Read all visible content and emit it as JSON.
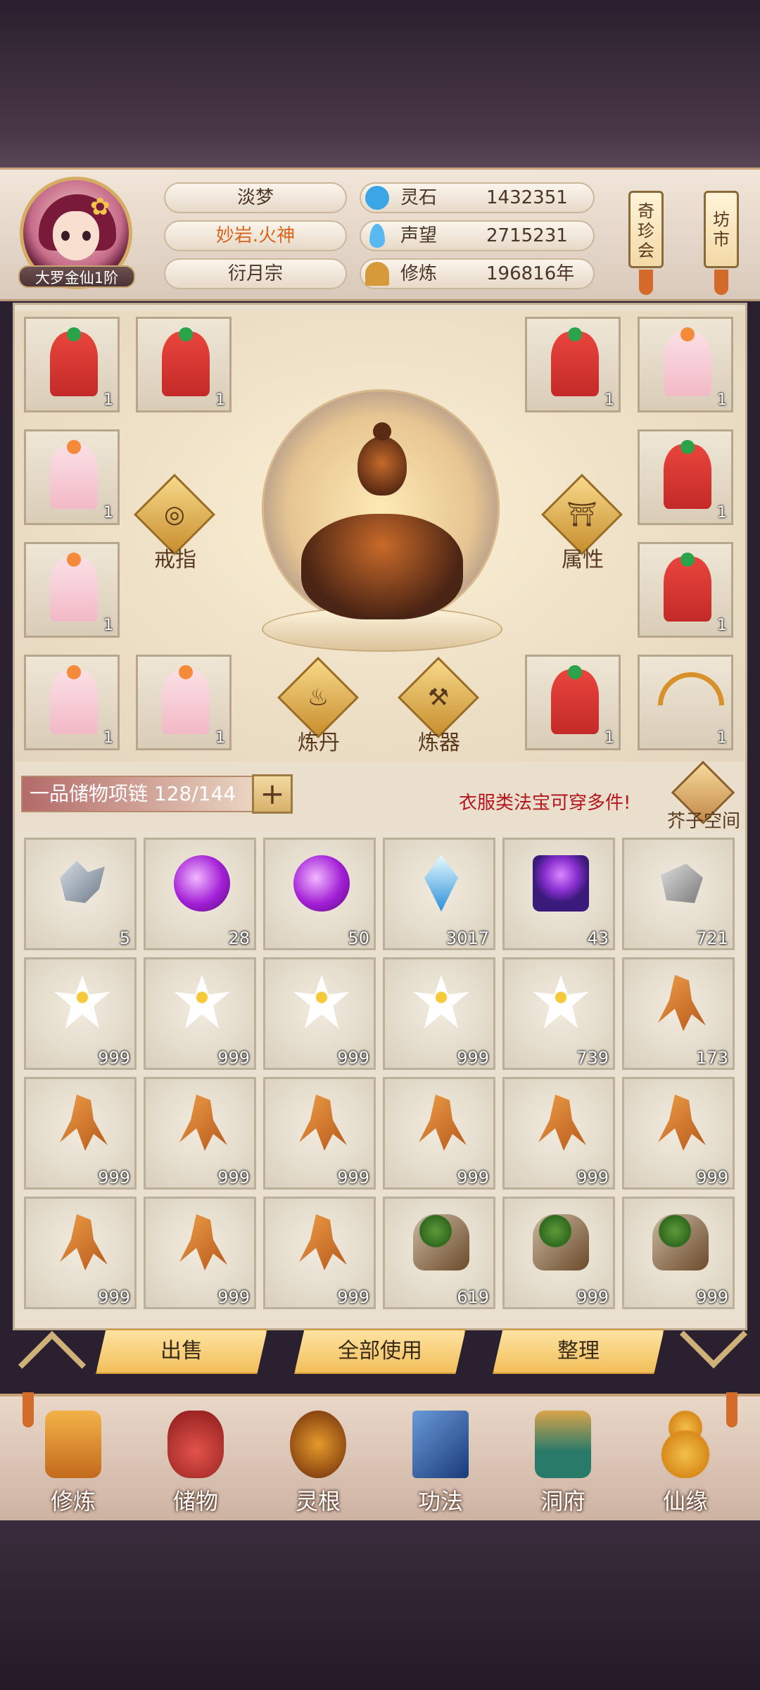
{
  "player": {
    "rank": "大罗金仙1阶",
    "name": "淡梦",
    "title": "妙岩.火神",
    "sect": "衍月宗"
  },
  "resources": [
    {
      "label": "灵石",
      "value": "1432351",
      "icon": "spirit-stone-icon",
      "color": "#3aa6e6"
    },
    {
      "label": "声望",
      "value": "2715231",
      "icon": "prestige-crystal-icon",
      "color": "#57b9f0"
    },
    {
      "label": "修炼",
      "value": "196816年",
      "icon": "meditation-figure-icon",
      "color": "#d69a3a"
    }
  ],
  "top_tags": [
    {
      "label": "奇\n珍\n会"
    },
    {
      "label": "坊\n市"
    }
  ],
  "equipment": {
    "slots": [
      {
        "type": "red-robe",
        "count": "1"
      },
      {
        "type": "red-robe",
        "count": "1"
      },
      {
        "type": "red-robe",
        "count": "1"
      },
      {
        "type": "pink-robe",
        "count": "1"
      },
      {
        "type": "pink-robe",
        "count": "1"
      },
      {
        "type": "red-robe",
        "count": "1"
      },
      {
        "type": "pink-robe",
        "count": "1"
      },
      {
        "type": "red-robe",
        "count": "1"
      },
      {
        "type": "pink-robe",
        "count": "1"
      },
      {
        "type": "pink-robe",
        "count": "1"
      },
      {
        "type": "red-robe",
        "count": "1"
      },
      {
        "type": "bow",
        "count": "1"
      }
    ],
    "ring_label": "戒指",
    "attr_label": "属性",
    "alchemy_label": "炼丹",
    "forge_label": "炼器"
  },
  "storage": {
    "bag_label": "一品储物项链 128/144",
    "plus": "+",
    "hint": "衣服类法宝可穿多件!",
    "space_label": "芥子空间",
    "items": [
      {
        "icon": "shard",
        "count": "5"
      },
      {
        "icon": "orb",
        "count": "28"
      },
      {
        "icon": "orb",
        "count": "50"
      },
      {
        "icon": "crystal",
        "count": "3017"
      },
      {
        "icon": "cube",
        "count": "43"
      },
      {
        "icon": "rock",
        "count": "721"
      },
      {
        "icon": "flower",
        "count": "999"
      },
      {
        "icon": "flower",
        "count": "999"
      },
      {
        "icon": "flower",
        "count": "999"
      },
      {
        "icon": "flower",
        "count": "999"
      },
      {
        "icon": "flower",
        "count": "739"
      },
      {
        "icon": "root",
        "count": "173"
      },
      {
        "icon": "root",
        "count": "999"
      },
      {
        "icon": "root",
        "count": "999"
      },
      {
        "icon": "root",
        "count": "999"
      },
      {
        "icon": "root",
        "count": "999"
      },
      {
        "icon": "root",
        "count": "999"
      },
      {
        "icon": "root",
        "count": "999"
      },
      {
        "icon": "root",
        "count": "999"
      },
      {
        "icon": "root",
        "count": "999"
      },
      {
        "icon": "root",
        "count": "999"
      },
      {
        "icon": "herb",
        "count": "619"
      },
      {
        "icon": "herb",
        "count": "999"
      },
      {
        "icon": "herb",
        "count": "999"
      }
    ],
    "buttons": {
      "sell": "出售",
      "use_all": "全部使用",
      "sort": "整理"
    }
  },
  "nav": [
    {
      "label": "修炼",
      "icon": "cultivate-icon",
      "color": "#d88a2a"
    },
    {
      "label": "储物",
      "icon": "storage-bag-icon",
      "color": "#c0302a"
    },
    {
      "label": "灵根",
      "icon": "spirit-root-icon",
      "color": "#b8641a"
    },
    {
      "label": "功法",
      "icon": "skill-book-icon",
      "color": "#2a5aa0"
    },
    {
      "label": "洞府",
      "icon": "cave-house-icon",
      "color": "#2a8a7a"
    },
    {
      "label": "仙缘",
      "icon": "gourd-icon",
      "color": "#e0a030"
    }
  ]
}
